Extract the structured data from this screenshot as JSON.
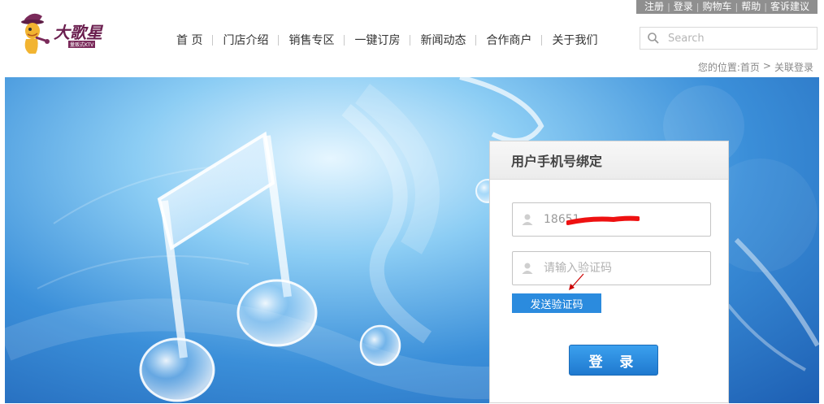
{
  "header": {
    "top_links": [
      "注册",
      "登录",
      "购物车",
      "帮助",
      "客诉建议"
    ],
    "logo_text": "大歌星",
    "logo_sub": "量贩式KTV",
    "nav": [
      "首 页",
      "门店介绍",
      "销售专区",
      "一键订房",
      "新闻动态",
      "合作商户",
      "关于我们"
    ],
    "search": {
      "placeholder": "Search",
      "icon": "search-icon"
    }
  },
  "breadcrumb": {
    "prefix": "您的位置:",
    "home": "首页",
    "sep": ">",
    "current": "关联登录"
  },
  "login_panel": {
    "title": "用户手机号绑定",
    "phone": {
      "value": "18651",
      "icon": "user-icon"
    },
    "code": {
      "placeholder": "请输入验证码",
      "icon": "user-icon"
    },
    "send_code_label": "发送验证码",
    "login_label": "登 录"
  },
  "colors": {
    "accent_blue": "#2b8bde",
    "top_bar": "#8f8f8f",
    "redaction": "#ee1111"
  }
}
